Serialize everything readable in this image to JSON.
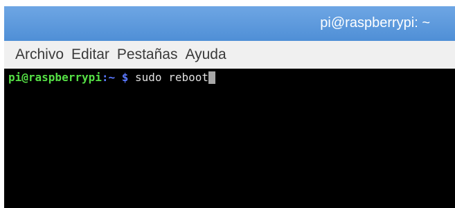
{
  "window": {
    "title": "pi@raspberrypi: ~"
  },
  "menu": {
    "items": [
      {
        "label": "Archivo"
      },
      {
        "label": "Editar"
      },
      {
        "label": "Pestañas"
      },
      {
        "label": "Ayuda"
      }
    ]
  },
  "terminal": {
    "prompt_user": "pi@raspberrypi",
    "prompt_path": ":~",
    "prompt_sign": " $",
    "command": " sudo reboot"
  },
  "colors": {
    "titlebar": "#5b98dc",
    "prompt_user": "#55e045",
    "prompt_path": "#5a78ff",
    "background": "#000000"
  }
}
